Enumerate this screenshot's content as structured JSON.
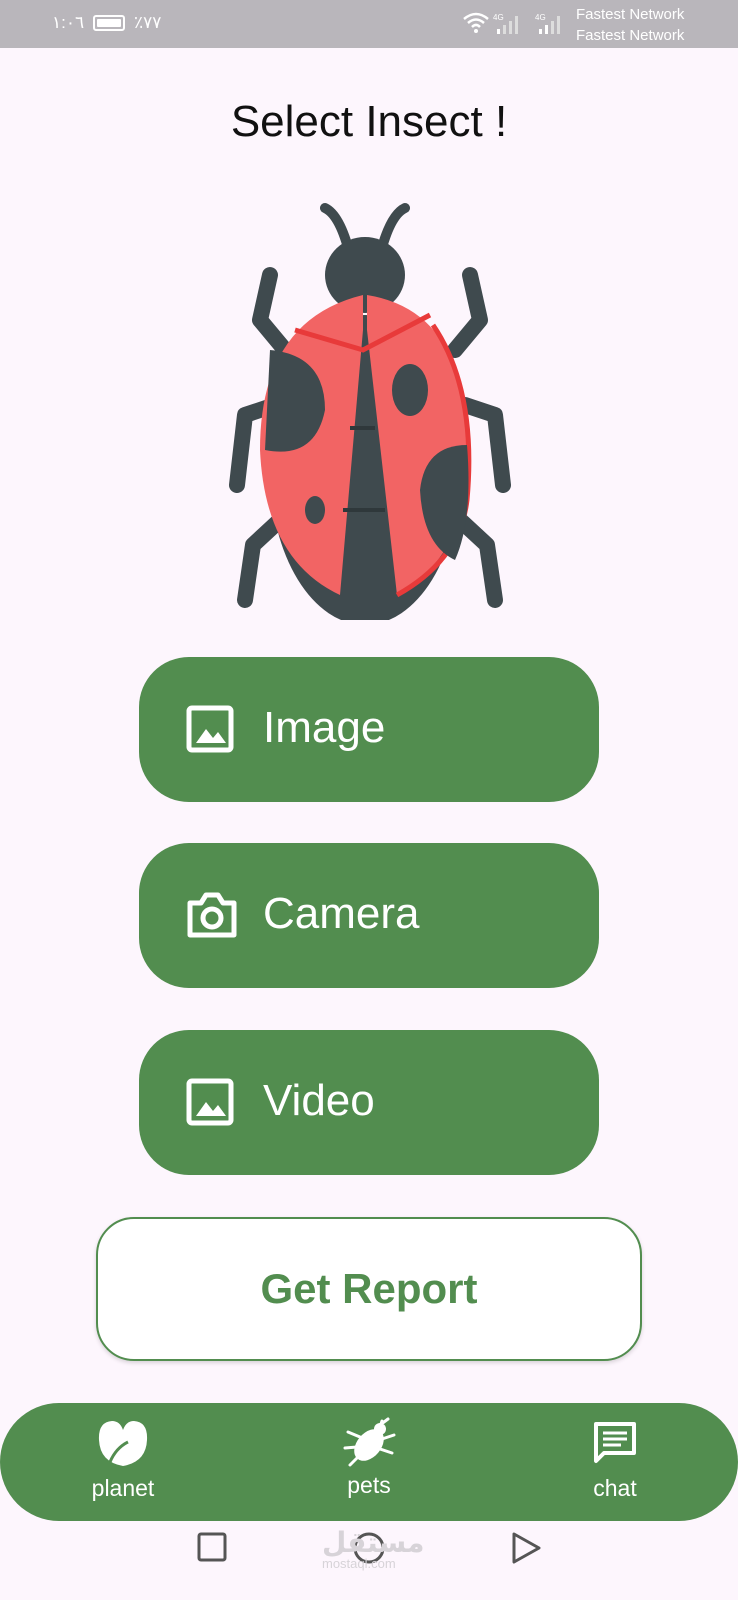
{
  "status_bar": {
    "time": "١:٠٦",
    "battery_percent": "٪٧٧",
    "network_1": "Fastest Network",
    "network_2": "Fastest Network",
    "signal_1_label": "4G",
    "signal_2_label": "4G"
  },
  "page": {
    "title": "Select Insect !",
    "illustration_icon": "ladybug-illustration"
  },
  "buttons": {
    "image": {
      "label": "Image",
      "icon": "image-icon"
    },
    "camera": {
      "label": "Camera",
      "icon": "camera-icon"
    },
    "video": {
      "label": "Video",
      "icon": "image-icon"
    },
    "report": {
      "label": "Get Report"
    }
  },
  "bottom_nav": {
    "items": [
      {
        "label": "planet",
        "icon": "leaf-icon"
      },
      {
        "label": "pets",
        "icon": "bug-icon"
      },
      {
        "label": "chat",
        "icon": "chat-icon"
      }
    ]
  },
  "system_nav": {
    "buttons": [
      "recent-apps",
      "home",
      "back"
    ]
  },
  "watermark": {
    "text": "مستقل",
    "sub": "mostaql.com"
  },
  "colors": {
    "accent_green": "#528d4f",
    "background": "#fdf6fd",
    "status_bar": "#b9b6bb",
    "ladybug_red": "#f26464",
    "ladybug_dark": "#3f4a4e"
  }
}
